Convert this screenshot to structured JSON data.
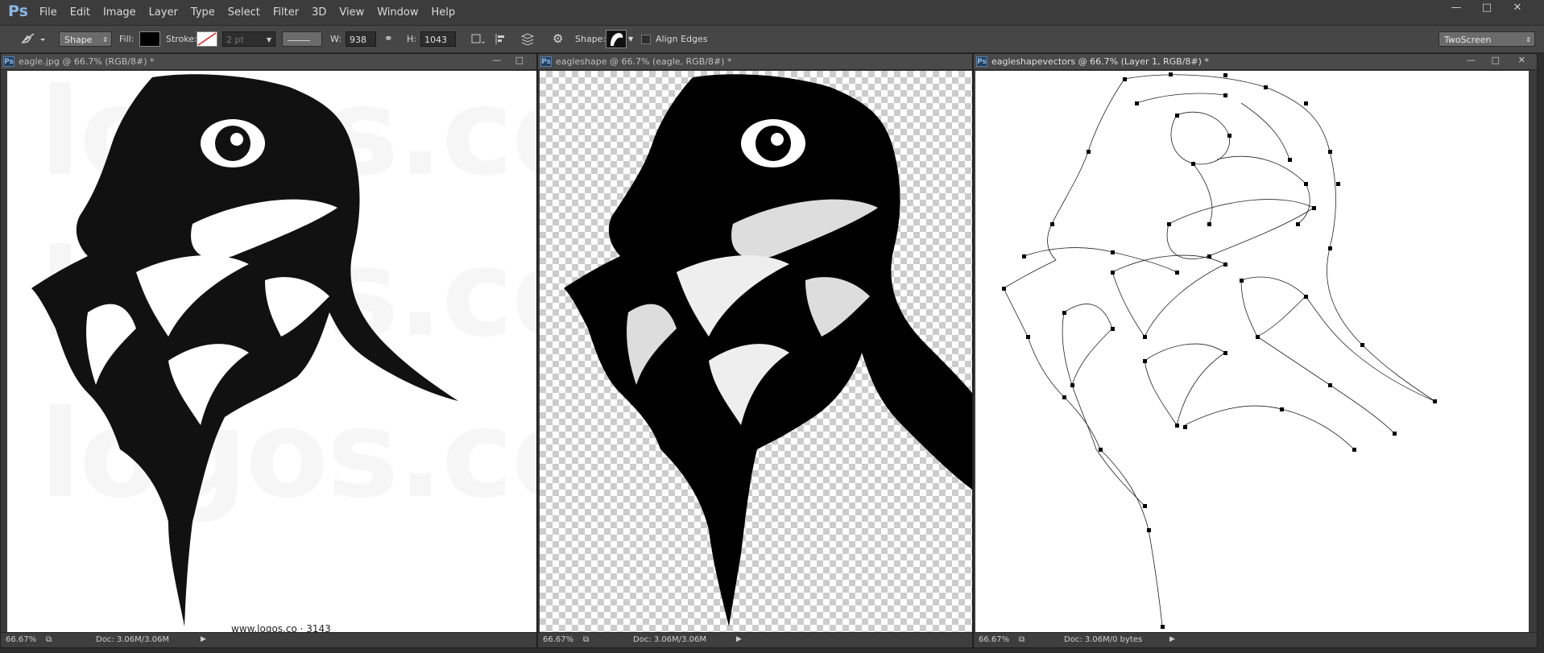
{
  "app": {
    "logo": "Ps"
  },
  "menu": [
    "File",
    "Edit",
    "Image",
    "Layer",
    "Type",
    "Select",
    "Filter",
    "3D",
    "View",
    "Window",
    "Help"
  ],
  "options": {
    "tool_mode": "Shape",
    "fill_label": "Fill:",
    "stroke_label": "Stroke:",
    "stroke_width": "2 pt",
    "w_label": "W:",
    "w_value": "938 px",
    "h_label": "H:",
    "h_value": "1043 px",
    "shape_label": "Shape:",
    "align_edges": "Align Edges",
    "workspace": "TwoScreen",
    "fill_color": "#000000"
  },
  "documents": [
    {
      "title": "eagle.jpg @ 66.7% (RGB/8#) *",
      "zoom": "66.67%",
      "doc_info": "Doc: 3.06M/3.06M",
      "caption": "www.logos.co  ·  3143",
      "watermark": "logos.co"
    },
    {
      "title": "eagleshape @ 66.7% (eagle, RGB/8#) *",
      "zoom": "66.67%",
      "doc_info": "Doc: 3.06M/3.06M"
    },
    {
      "title": "eagleshapevectors @ 66.7% (Layer 1, RGB/8#) *",
      "zoom": "66.67%",
      "doc_info": "Doc: 3.06M/0 bytes"
    }
  ]
}
